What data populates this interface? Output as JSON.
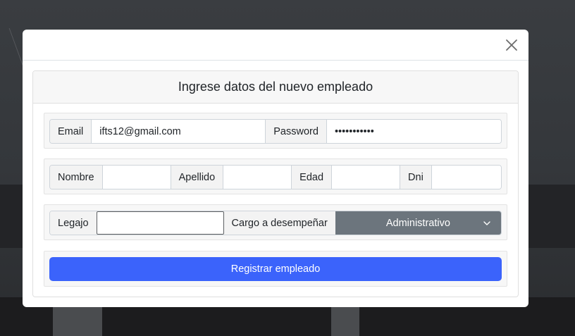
{
  "modal": {
    "close_icon": "close-icon"
  },
  "form": {
    "title": "Ingrese datos del nuevo empleado",
    "email": {
      "label": "Email",
      "value": "ifts12@gmail.com"
    },
    "password": {
      "label": "Password",
      "value": "•••••••••••"
    },
    "nombre": {
      "label": "Nombre",
      "value": ""
    },
    "apellido": {
      "label": "Apellido",
      "value": ""
    },
    "edad": {
      "label": "Edad",
      "value": ""
    },
    "dni": {
      "label": "Dni",
      "value": ""
    },
    "legajo": {
      "label": "Legajo",
      "value": ""
    },
    "cargo": {
      "label": "Cargo a desempeñar",
      "selected": "Administrativo",
      "icon": "chevron-down-icon"
    },
    "submit_label": "Registrar empleado"
  },
  "colors": {
    "primary": "#3b63fb",
    "select_bg": "#6c757d"
  }
}
